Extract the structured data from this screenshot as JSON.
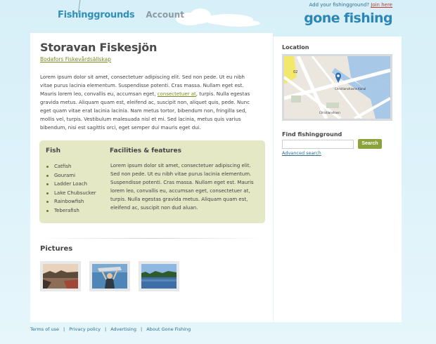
{
  "header": {
    "nav_logo": "Fishinggrounds",
    "nav_account": "Account",
    "prompt_text": "Add your fishingground?",
    "join_link": "Join here",
    "brand": "gone fishing"
  },
  "main": {
    "title": "Storavan Fiskesjön",
    "subtitle": "Bodafors Fiskevårdsällskap",
    "body_before": "Lorem ipsum dolor sit amet, consectetuer adipiscing elit. Sed non pede. Ut eu nibh vitae purus lacinia elementum. Suspendisse potenti. Cras massa. Nullam eget est. Mauris lorem leo, convallis eu, accumsan eget, ",
    "body_link": "consectetuer at",
    "body_after": ", turpis. Nulla egestas gravida metus. Aliquam quam est, eleifend ac, suscipit non, aliquet quis, pede. Nunc eget quam vitae erat lacinia lacinia. Nam metus tortor, bibendum non, fringilla sed, mollis vel, turpis. Vestibulum malesuada nisl et mi. Sed lacinia, metus quis varius bibendum, nisi est sagittis orci, eget semper dui mauris eget dui.",
    "fish_heading": "Fish",
    "fish_list": [
      "Catfish",
      "Gourami",
      "Ladder Loach",
      "Lake Chubsucker",
      "Rainbowfish",
      "Teberafish"
    ],
    "facilities_heading": "Facilities & features",
    "facilities_text": "Lorem ipsum dolor sit amet, consectetuer adipiscing elit. Sed non pede. Ut eu nibh vitae purus lacinia elementum. Suspendisse potenti. Cras massa. Nullam eget est. Mauris lorem leo, convallis eu, accumsan eget, consectetuer at, turpis. Nulla egestas gravida metus. Aliquam quam est, eleifend ac, suscipit non dud aluan.",
    "pictures_heading": "Pictures"
  },
  "sidebar": {
    "location_heading": "Location",
    "map_labels": [
      "02",
      "Christianshavns Kanal",
      "Christianshavn"
    ],
    "find_heading": "Find fishingground",
    "search_placeholder": "",
    "search_button": "Search",
    "advanced_link": "Advanced search"
  },
  "footer": {
    "links": [
      "Terms of use",
      "Privacy policy",
      "Advertising",
      "About Gone Fishing"
    ]
  },
  "colors": {
    "accent_blue": "#2c86b6",
    "link_red": "#c03a2b",
    "olive": "#7a8a1e",
    "green_box": "#e4e8c4",
    "search_button": "#8aa33c"
  }
}
